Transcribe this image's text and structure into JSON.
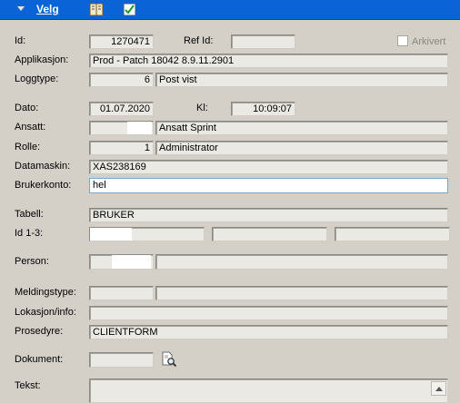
{
  "toolbar": {
    "menu_label": "Velg",
    "icons": [
      "book-icon",
      "checklist-icon"
    ]
  },
  "labels": {
    "id": "Id:",
    "ref_id": "Ref Id:",
    "arkivert": "Arkivert",
    "applikasjon": "Applikasjon:",
    "loggtype": "Loggtype:",
    "dato": "Dato:",
    "kl": "Kl:",
    "ansatt": "Ansatt:",
    "rolle": "Rolle:",
    "datamaskin": "Datamaskin:",
    "brukerkonto": "Brukerkonto:",
    "tabell": "Tabell:",
    "id13": "Id 1-3:",
    "person": "Person:",
    "meldingstype": "Meldingstype:",
    "lokasjon": "Lokasjon/info:",
    "prosedyre": "Prosedyre:",
    "dokument": "Dokument:",
    "tekst": "Tekst:"
  },
  "values": {
    "id": "1270471",
    "ref_id": "",
    "arkivert": false,
    "applikasjon": "Prod - Patch 18042 8.9.11.2901",
    "loggtype_code": "6",
    "loggtype_name": "Post vist",
    "dato": "01.07.2020",
    "kl": "10:09:07",
    "ansatt_code": "",
    "ansatt_name": "Ansatt Sprint",
    "rolle_code": "1",
    "rolle_name": "Administrator",
    "datamaskin": "XAS238169",
    "brukerkonto": "hel",
    "tabell": "BRUKER",
    "id1": "",
    "id2": "",
    "id3": "",
    "person_code": "",
    "person_name": "",
    "meldingstype_code": "",
    "meldingstype_name": "",
    "lokasjon": "",
    "prosedyre": "CLIENTFORM",
    "dokument": "",
    "tekst": ""
  },
  "colors": {
    "titlebar": "#0a63d7",
    "background": "#d4d0c8",
    "field": "#ebe9e3"
  }
}
